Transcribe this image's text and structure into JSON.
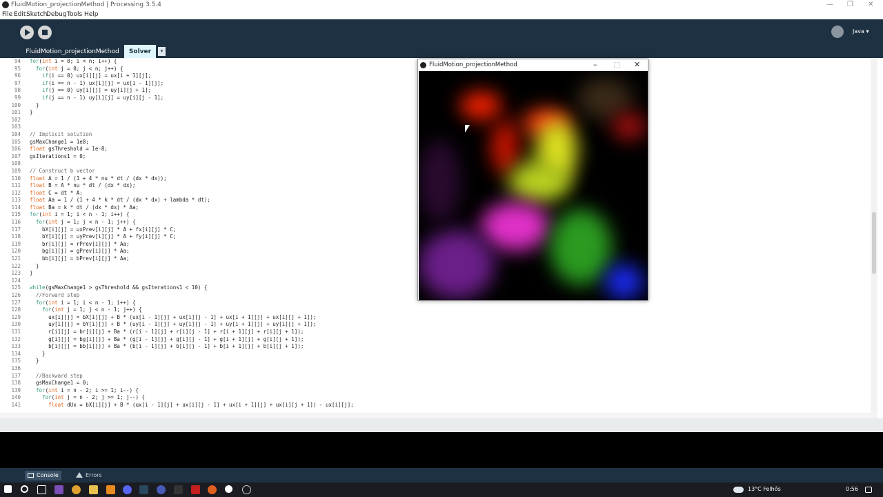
{
  "window": {
    "title": "FluidMotion_projectionMethod | Processing 3.5.4"
  },
  "menu": [
    "File",
    "Edit",
    "Sketch",
    "Debug",
    "Tools",
    "Help"
  ],
  "toolbar": {
    "mode": "Java ▾"
  },
  "tabs": [
    "FluidMotion_projectionMethod",
    "Solver"
  ],
  "tab_dropdown": "▾",
  "editor": {
    "line_numbers": [
      "94",
      "95",
      "96",
      "97",
      "98",
      "99",
      "100",
      "101",
      "102",
      "103",
      "104",
      "105",
      "106",
      "107",
      "108",
      "109",
      "110",
      "111",
      "112",
      "113",
      "114",
      "115",
      "116",
      "117",
      "118",
      "119",
      "120",
      "121",
      "122",
      "123",
      "124",
      "125",
      "126",
      "127",
      "128",
      "129",
      "130",
      "131",
      "132",
      "133",
      "134",
      "135",
      "136",
      "137",
      "138",
      "139",
      "140",
      "141"
    ],
    "lines": [
      "for(int i = 0; i < n; i++) {",
      "  for(int j = 0; j < n; j++) {",
      "    if(i == 0) ux[i][j] = ux[i + 1][j];",
      "    if(i == n - 1) ux[i][j] = ux[i - 1][j];",
      "    if(j == 0) uy[i][j] = uy[i][j + 1];",
      "    if(j == n - 1) uy[i][j] = uy[i][j - 1];",
      "  }",
      "}",
      "",
      "",
      "// Implicit solution",
      "gsMaxChange1 = 1e8;",
      "float gsThreshold = 1e-8;",
      "gsIterations1 = 0;",
      "",
      "// Construct b vector",
      "float A = 1 / (1 + 4 * nu * dt / (dx * dx));",
      "float B = A * nu * dt / (dx * dx);",
      "float C = dt * A;",
      "float Aa = 1 / (1 + 4 * k * dt / (dx * dx) + lambda * dt);",
      "float Ba = k * dt / (dx * dx) * Aa;",
      "for(int i = 1; i < n - 1; i++) {",
      "  for(int j = 1; j < n - 1; j++) {",
      "    bX[i][j] = uxPrev[i][j] * A + fx[i][j] * C;",
      "    bY[i][j] = uyPrev[i][j] * A + fy[i][j] * C;",
      "    br[i][j] = rPrev[i][j] * Aa;",
      "    bg[i][j] = gPrev[i][j] * Aa;",
      "    bb[i][j] = bPrev[i][j] * Aa;",
      "  }",
      "}",
      "",
      "while(gsMaxChange1 > gsThreshold && gsIterations1 < 10) {",
      "  //Forward step",
      "  for(int i = 1; i < n - 1; i++) {",
      "    for(int j = 1; j < n - 1; j++) {",
      "      ux[i][j] = bX[i][j] + B * (ux[i - 1][j] + ux[i][j - 1] + ux[i + 1][j] + ux[i][j + 1]);",
      "      uy[i][j] = bY[i][j] + B * (uy[i - 1][j] + uy[i][j - 1] + uy[i + 1][j] + uy[i][j + 1]);",
      "      r[i][j] = br[i][j] + Ba * (r[i - 1][j] + r[i][j - 1] + r[i + 1][j] + r[i][j + 1]);",
      "      g[i][j] = bg[i][j] + Ba * (g[i - 1][j] + g[i][j - 1] + g[i + 1][j] + g[i][j + 1]);",
      "      b[i][j] = bb[i][j] + Ba * (b[i - 1][j] + b[i][j - 1] + b[i + 1][j] + b[i][j + 1]);",
      "    }",
      "  }",
      "",
      "  //Backward step",
      "  gsMaxChange1 = 0;",
      "  for(int i = n - 2; i >= 1; i--) {",
      "    for(int j = n - 2; j >= 1; j--) {",
      "      float dUx = bX[i][j] + B * (ux[i - 1][j] + ux[i][j - 1] + ux[i + 1][j] + ux[i][j + 1]) - ux[i][j];"
    ]
  },
  "console_tabs": [
    "Console",
    "Errors"
  ],
  "sketch_window": {
    "title": "FluidMotion_projectionMethod"
  },
  "taskbar": {
    "weather": "13°C Felhős",
    "time": "0:56"
  },
  "colors": {
    "toolbar": "#1e3142",
    "keyword": "#33997e",
    "type": "#e2661a",
    "comment": "#666666"
  }
}
